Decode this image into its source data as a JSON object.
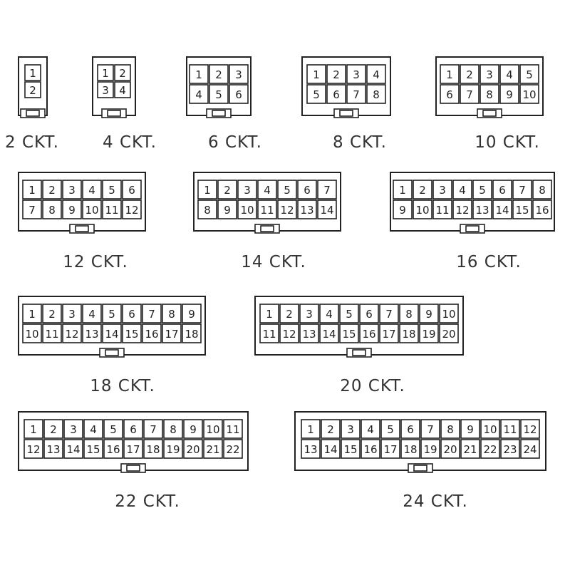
{
  "connectors": [
    {
      "id": "2",
      "label": "2 CKT.",
      "pins": 2,
      "rows": [
        [
          "1"
        ],
        [
          "2"
        ]
      ]
    },
    {
      "id": "4",
      "label": "4 CKT.",
      "pins": 4,
      "rows": [
        [
          "1",
          "2"
        ],
        [
          "3",
          "4"
        ]
      ]
    },
    {
      "id": "6",
      "label": "6 CKT.",
      "pins": 6,
      "rows": [
        [
          "1",
          "2",
          "3"
        ],
        [
          "4",
          "5",
          "6"
        ]
      ]
    },
    {
      "id": "8",
      "label": "8 CKT.",
      "pins": 8,
      "rows": [
        [
          "1",
          "2",
          "3",
          "4"
        ],
        [
          "5",
          "6",
          "7",
          "8"
        ]
      ]
    },
    {
      "id": "10",
      "label": "10 CKT.",
      "pins": 10,
      "rows": [
        [
          "1",
          "2",
          "3",
          "4",
          "5"
        ],
        [
          "6",
          "7",
          "8",
          "9",
          "10"
        ]
      ]
    },
    {
      "id": "12",
      "label": "12 CKT.",
      "pins": 12,
      "rows": [
        [
          "1",
          "2",
          "3",
          "4",
          "5",
          "6"
        ],
        [
          "7",
          "8",
          "9",
          "10",
          "11",
          "12"
        ]
      ]
    },
    {
      "id": "14",
      "label": "14 CKT.",
      "pins": 14,
      "rows": [
        [
          "1",
          "2",
          "3",
          "4",
          "5",
          "6",
          "7"
        ],
        [
          "8",
          "9",
          "10",
          "11",
          "12",
          "13",
          "14"
        ]
      ]
    },
    {
      "id": "16",
      "label": "16 CKT.",
      "pins": 16,
      "rows": [
        [
          "1",
          "2",
          "3",
          "4",
          "5",
          "6",
          "7",
          "8"
        ],
        [
          "9",
          "10",
          "11",
          "12",
          "13",
          "14",
          "15",
          "16"
        ]
      ]
    },
    {
      "id": "18",
      "label": "18 CKT.",
      "pins": 18,
      "rows": [
        [
          "1",
          "2",
          "3",
          "4",
          "5",
          "6",
          "7",
          "8",
          "9"
        ],
        [
          "10",
          "11",
          "12",
          "13",
          "14",
          "15",
          "16",
          "17",
          "18"
        ]
      ]
    },
    {
      "id": "20",
      "label": "20 CKT.",
      "pins": 20,
      "rows": [
        [
          "1",
          "2",
          "3",
          "4",
          "5",
          "6",
          "7",
          "8",
          "9",
          "10"
        ],
        [
          "11",
          "12",
          "13",
          "14",
          "15",
          "16",
          "17",
          "18",
          "19",
          "20"
        ]
      ]
    },
    {
      "id": "22",
      "label": "22 CKT.",
      "pins": 22,
      "rows": [
        [
          "1",
          "2",
          "3",
          "4",
          "5",
          "6",
          "7",
          "8",
          "9",
          "10",
          "11"
        ],
        [
          "12",
          "13",
          "14",
          "15",
          "16",
          "17",
          "18",
          "19",
          "20",
          "21",
          "22"
        ]
      ]
    },
    {
      "id": "24",
      "label": "24 CKT.",
      "pins": 24,
      "rows": [
        [
          "1",
          "2",
          "3",
          "4",
          "5",
          "6",
          "7",
          "8",
          "9",
          "10",
          "11",
          "12"
        ],
        [
          "13",
          "14",
          "15",
          "16",
          "17",
          "18",
          "19",
          "20",
          "21",
          "22",
          "23",
          "24"
        ]
      ]
    }
  ]
}
